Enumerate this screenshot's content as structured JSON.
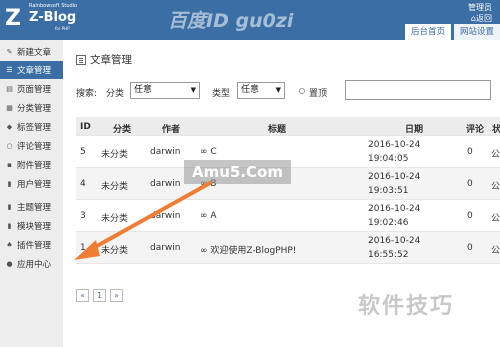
{
  "header": {
    "logo_studio": "Rainbowsoft Studio",
    "logo_letter": "Z",
    "logo_name": "Z-Blog",
    "logo_sub": "for PHP",
    "watermark": "百度ID gu0zi",
    "user_label": "管理员",
    "back_label": "返回",
    "tabs": [
      {
        "label": "后台首页"
      },
      {
        "label": "网站设置"
      }
    ]
  },
  "sidebar": {
    "items": [
      {
        "label": "新建文章",
        "icon": "new-article-icon",
        "active": false
      },
      {
        "label": "文章管理",
        "icon": "article-manage-icon",
        "active": true
      },
      {
        "label": "页面管理",
        "icon": "page-manage-icon",
        "active": false
      },
      {
        "label": "分类管理",
        "icon": "category-manage-icon",
        "active": false
      },
      {
        "label": "标签管理",
        "icon": "tag-manage-icon",
        "active": false
      },
      {
        "label": "评论管理",
        "icon": "comment-manage-icon",
        "active": false
      },
      {
        "label": "附件管理",
        "icon": "attachment-manage-icon",
        "active": false
      },
      {
        "label": "用户管理",
        "icon": "user-manage-icon",
        "active": false
      },
      {
        "label": "主题管理",
        "icon": "theme-manage-icon",
        "active": false
      },
      {
        "label": "模块管理",
        "icon": "module-manage-icon",
        "active": false
      },
      {
        "label": "插件管理",
        "icon": "plugin-manage-icon",
        "active": false
      },
      {
        "label": "应用中心",
        "icon": "app-center-icon",
        "active": false
      }
    ]
  },
  "main": {
    "title": "文章管理",
    "search": {
      "label": "搜索:",
      "category_label": "分类",
      "category_value": "任意",
      "type_label": "类型",
      "type_value": "任意",
      "top_label": "置顶"
    },
    "table": {
      "headers": [
        "ID",
        "分类",
        "作者",
        "标题",
        "日期",
        "评论",
        "状"
      ],
      "rows": [
        {
          "id": "5",
          "category": "未分类",
          "author": "darwin",
          "title": "C",
          "date": "2016-10-24",
          "time": "19:04:05",
          "comments": "0",
          "status": "公"
        },
        {
          "id": "4",
          "category": "未分类",
          "author": "darwin",
          "title": "B",
          "date": "2016-10-24",
          "time": "19:03:51",
          "comments": "0",
          "status": "公"
        },
        {
          "id": "3",
          "category": "未分类",
          "author": "darwin",
          "title": "A",
          "date": "2016-10-24",
          "time": "19:02:46",
          "comments": "0",
          "status": "公"
        },
        {
          "id": "1",
          "category": "未分类",
          "author": "darwin",
          "title": "欢迎使用Z-BlogPHP!",
          "date": "2016-10-24",
          "time": "16:55:52",
          "comments": "0",
          "status": "公"
        }
      ]
    },
    "pagination": {
      "first": "«",
      "page": "1",
      "last": "»"
    }
  },
  "overlay": {
    "mid_watermark": "Amu5.Com",
    "bottom_watermark": "软件技巧"
  },
  "colors": {
    "header_bg": "#3a6ea5",
    "accent": "#3a6ea5",
    "sidebar_bg": "#ededed",
    "arrow": "#ef7d33"
  }
}
